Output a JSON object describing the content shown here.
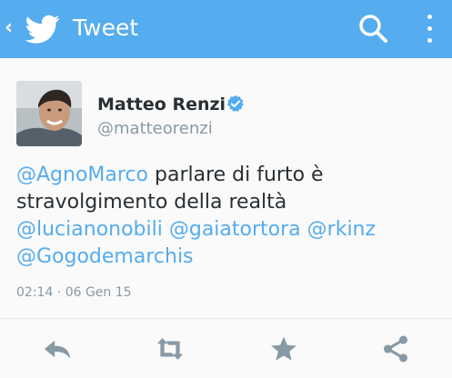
{
  "header": {
    "back_glyph": "‹",
    "title": "Tweet",
    "brand_icon": "twitter-bird-icon",
    "search_icon": "search-icon",
    "overflow_icon": "more-vertical-icon",
    "color": "#55acee"
  },
  "tweet": {
    "author": {
      "display_name": "Matteo Renzi",
      "handle": "@matteorenzi",
      "verified_icon": "verified-badge-icon"
    },
    "text": {
      "mention_1": "@AgnoMarco",
      "body_line1": " parlare di furto è",
      "body_line2": "stravolgimento della realtà",
      "mention_2": "@lucianonobili",
      "mention_3": "@gaiatortora",
      "mention_4": "@rkinz",
      "mention_5": "@Gogodemarchis"
    },
    "timestamp": "02:14 · 06 Gen 15"
  },
  "actions": [
    {
      "name": "reply-icon"
    },
    {
      "name": "retweet-icon"
    },
    {
      "name": "favorite-star-icon"
    },
    {
      "name": "share-icon"
    }
  ],
  "colors": {
    "link": "#55acee",
    "text": "#292f33",
    "muted": "#8899a6",
    "action_icons": "#8899a6"
  }
}
